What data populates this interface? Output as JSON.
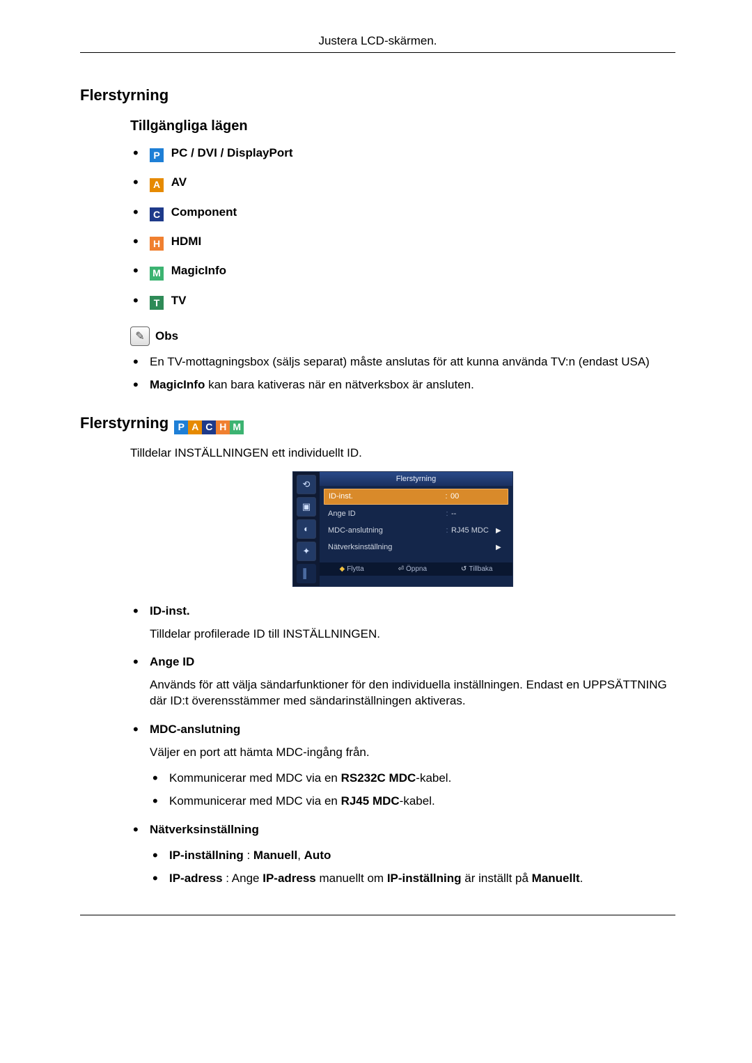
{
  "header": {
    "title": "Justera LCD-skärmen."
  },
  "section1": {
    "heading": "Flerstyrning",
    "sub": "Tillgängliga lägen",
    "modes": {
      "p_letter": "P",
      "p_label": "PC / DVI / DisplayPort",
      "a_letter": "A",
      "a_label": "AV",
      "c_letter": "C",
      "c_label": "Component",
      "h_letter": "H",
      "h_label": "HDMI",
      "m_letter": "M",
      "m_label": "MagicInfo",
      "t_letter": "T",
      "t_label": "TV"
    },
    "obs_label": "Obs",
    "note1": "En TV-mottagningsbox (säljs separat) måste anslutas för att kunna använda TV:n (endast USA)",
    "note2_bold": "MagicInfo",
    "note2_rest": " kan bara kativeras när en nätverksbox är ansluten."
  },
  "section2": {
    "heading": "Flerstyrning",
    "strip": {
      "p": "P",
      "a": "A",
      "c": "C",
      "h": "H",
      "m": "M"
    },
    "intro": "Tilldelar INSTÄLLNINGEN ett individuellt ID.",
    "osd": {
      "title": "Flerstyrning",
      "rows": {
        "r1_label": "ID-inst.",
        "r1_sep": ":",
        "r1_val": "00",
        "r2_label": "Ange ID",
        "r2_sep": ":",
        "r2_val": "--",
        "r3_label": "MDC-anslutning",
        "r3_sep": ":",
        "r3_val": "RJ45 MDC",
        "r3_arrow": "▶",
        "r4_label": "Nätverksinställning",
        "r4_arrow": "▶"
      },
      "footer": {
        "move": "Flytta",
        "open": "Öppna",
        "back": "Tillbaka"
      }
    },
    "items": {
      "id_inst_title": "ID-inst.",
      "id_inst_body": "Tilldelar profilerade ID till INSTÄLLNINGEN.",
      "ange_title": "Ange ID",
      "ange_body": "Används för att välja sändarfunktioner för den individuella inställningen. Endast en UPPSÄTTNING där ID:t överensstämmer med sändarinställningen aktiveras.",
      "mdc_title": "MDC-anslutning",
      "mdc_body": "Väljer en port att hämta MDC-ingång från.",
      "mdc_sub1_pre": "Kommunicerar med MDC via en ",
      "mdc_sub1_bold": "RS232C MDC",
      "mdc_sub1_post": "-kabel.",
      "mdc_sub2_pre": "Kommunicerar med MDC via en ",
      "mdc_sub2_bold": "RJ45 MDC",
      "mdc_sub2_post": "-kabel.",
      "net_title": "Nätverksinställning",
      "net_sub1_bold": "IP-inställning",
      "net_sub1_sep": " : ",
      "net_sub1_v1": "Manuell",
      "net_sub1_comma": ", ",
      "net_sub1_v2": "Auto",
      "net_sub2_bold1": "IP-adress",
      "net_sub2_sep": " : Ange ",
      "net_sub2_bold2": "IP-adress",
      "net_sub2_mid": " manuellt om ",
      "net_sub2_bold3": "IP-inställning",
      "net_sub2_mid2": " är inställt på ",
      "net_sub2_bold4": "Manuellt",
      "net_sub2_end": "."
    }
  }
}
